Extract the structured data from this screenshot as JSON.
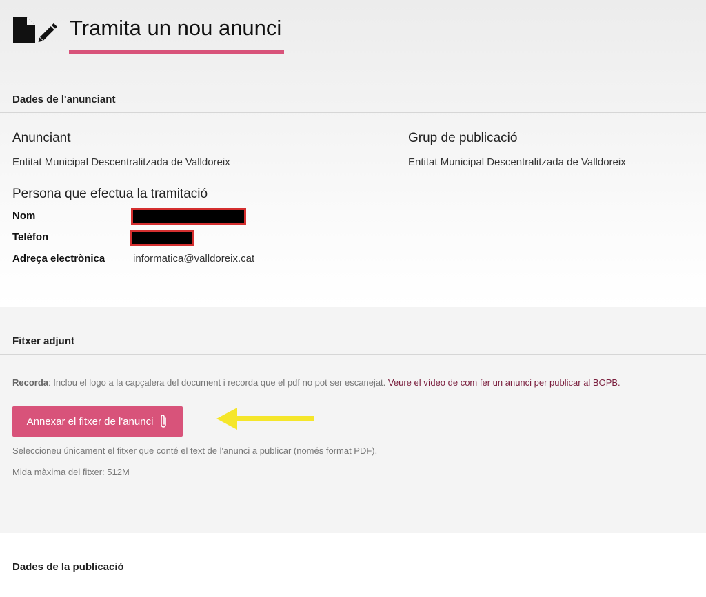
{
  "header": {
    "title": "Tramita un nou anunci",
    "icon": "file-edit-icon",
    "accent": "#d8537a"
  },
  "advertiser": {
    "section_title": "Dades de l'anunciant",
    "advertiser_label": "Anunciant",
    "advertiser_value": "Entitat Municipal Descentralitzada de Valldoreix",
    "group_label": "Grup de publicació",
    "group_value": "Entitat Municipal Descentralitzada de Valldoreix",
    "person_title": "Persona que efectua la tramitació",
    "name_label": "Nom",
    "phone_label": "Telèfon",
    "email_label": "Adreça electrònica",
    "email_value": "informatica@valldoreix.cat"
  },
  "attachment": {
    "section_title": "Fitxer adjunt",
    "note_bold": "Recorda",
    "note_text": ": Inclou el logo a la capçalera del document i recorda que el pdf no pot ser escanejat. ",
    "note_link": "Veure el vídeo de com fer un anunci per publicar al BOPB.",
    "button_label": "Annexar el fitxer de l'anunci",
    "button_icon": "paperclip-icon",
    "help_text": "Seleccioneu únicament el fitxer que conté el text de l'anunci a publicar (només format PDF).",
    "max_size": "Mida màxima del fitxer: 512M",
    "arrow_color": "#f5e62a"
  },
  "publication": {
    "section_title": "Dades de la publicació"
  }
}
